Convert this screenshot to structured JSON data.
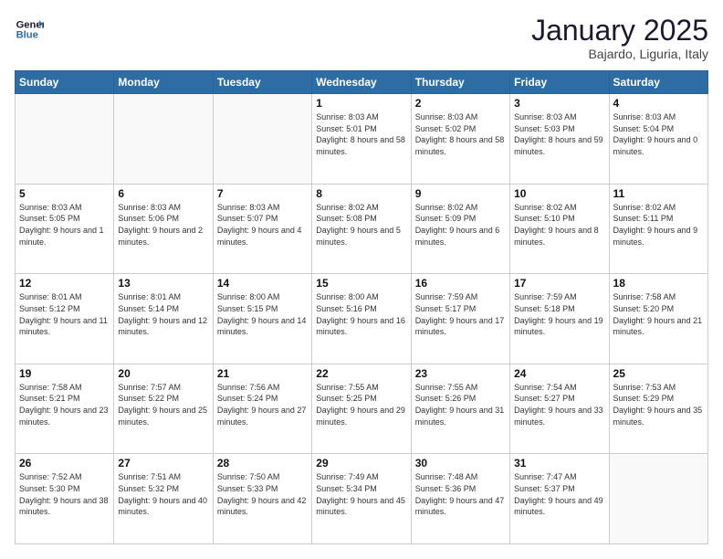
{
  "header": {
    "logo_line1": "General",
    "logo_line2": "Blue",
    "month_title": "January 2025",
    "location": "Bajardo, Liguria, Italy"
  },
  "weekdays": [
    "Sunday",
    "Monday",
    "Tuesday",
    "Wednesday",
    "Thursday",
    "Friday",
    "Saturday"
  ],
  "weeks": [
    [
      {
        "day": "",
        "sunrise": "",
        "sunset": "",
        "daylight": ""
      },
      {
        "day": "",
        "sunrise": "",
        "sunset": "",
        "daylight": ""
      },
      {
        "day": "",
        "sunrise": "",
        "sunset": "",
        "daylight": ""
      },
      {
        "day": "1",
        "sunrise": "Sunrise: 8:03 AM",
        "sunset": "Sunset: 5:01 PM",
        "daylight": "Daylight: 8 hours and 58 minutes."
      },
      {
        "day": "2",
        "sunrise": "Sunrise: 8:03 AM",
        "sunset": "Sunset: 5:02 PM",
        "daylight": "Daylight: 8 hours and 58 minutes."
      },
      {
        "day": "3",
        "sunrise": "Sunrise: 8:03 AM",
        "sunset": "Sunset: 5:03 PM",
        "daylight": "Daylight: 8 hours and 59 minutes."
      },
      {
        "day": "4",
        "sunrise": "Sunrise: 8:03 AM",
        "sunset": "Sunset: 5:04 PM",
        "daylight": "Daylight: 9 hours and 0 minutes."
      }
    ],
    [
      {
        "day": "5",
        "sunrise": "Sunrise: 8:03 AM",
        "sunset": "Sunset: 5:05 PM",
        "daylight": "Daylight: 9 hours and 1 minute."
      },
      {
        "day": "6",
        "sunrise": "Sunrise: 8:03 AM",
        "sunset": "Sunset: 5:06 PM",
        "daylight": "Daylight: 9 hours and 2 minutes."
      },
      {
        "day": "7",
        "sunrise": "Sunrise: 8:03 AM",
        "sunset": "Sunset: 5:07 PM",
        "daylight": "Daylight: 9 hours and 4 minutes."
      },
      {
        "day": "8",
        "sunrise": "Sunrise: 8:02 AM",
        "sunset": "Sunset: 5:08 PM",
        "daylight": "Daylight: 9 hours and 5 minutes."
      },
      {
        "day": "9",
        "sunrise": "Sunrise: 8:02 AM",
        "sunset": "Sunset: 5:09 PM",
        "daylight": "Daylight: 9 hours and 6 minutes."
      },
      {
        "day": "10",
        "sunrise": "Sunrise: 8:02 AM",
        "sunset": "Sunset: 5:10 PM",
        "daylight": "Daylight: 9 hours and 8 minutes."
      },
      {
        "day": "11",
        "sunrise": "Sunrise: 8:02 AM",
        "sunset": "Sunset: 5:11 PM",
        "daylight": "Daylight: 9 hours and 9 minutes."
      }
    ],
    [
      {
        "day": "12",
        "sunrise": "Sunrise: 8:01 AM",
        "sunset": "Sunset: 5:12 PM",
        "daylight": "Daylight: 9 hours and 11 minutes."
      },
      {
        "day": "13",
        "sunrise": "Sunrise: 8:01 AM",
        "sunset": "Sunset: 5:14 PM",
        "daylight": "Daylight: 9 hours and 12 minutes."
      },
      {
        "day": "14",
        "sunrise": "Sunrise: 8:00 AM",
        "sunset": "Sunset: 5:15 PM",
        "daylight": "Daylight: 9 hours and 14 minutes."
      },
      {
        "day": "15",
        "sunrise": "Sunrise: 8:00 AM",
        "sunset": "Sunset: 5:16 PM",
        "daylight": "Daylight: 9 hours and 16 minutes."
      },
      {
        "day": "16",
        "sunrise": "Sunrise: 7:59 AM",
        "sunset": "Sunset: 5:17 PM",
        "daylight": "Daylight: 9 hours and 17 minutes."
      },
      {
        "day": "17",
        "sunrise": "Sunrise: 7:59 AM",
        "sunset": "Sunset: 5:18 PM",
        "daylight": "Daylight: 9 hours and 19 minutes."
      },
      {
        "day": "18",
        "sunrise": "Sunrise: 7:58 AM",
        "sunset": "Sunset: 5:20 PM",
        "daylight": "Daylight: 9 hours and 21 minutes."
      }
    ],
    [
      {
        "day": "19",
        "sunrise": "Sunrise: 7:58 AM",
        "sunset": "Sunset: 5:21 PM",
        "daylight": "Daylight: 9 hours and 23 minutes."
      },
      {
        "day": "20",
        "sunrise": "Sunrise: 7:57 AM",
        "sunset": "Sunset: 5:22 PM",
        "daylight": "Daylight: 9 hours and 25 minutes."
      },
      {
        "day": "21",
        "sunrise": "Sunrise: 7:56 AM",
        "sunset": "Sunset: 5:24 PM",
        "daylight": "Daylight: 9 hours and 27 minutes."
      },
      {
        "day": "22",
        "sunrise": "Sunrise: 7:55 AM",
        "sunset": "Sunset: 5:25 PM",
        "daylight": "Daylight: 9 hours and 29 minutes."
      },
      {
        "day": "23",
        "sunrise": "Sunrise: 7:55 AM",
        "sunset": "Sunset: 5:26 PM",
        "daylight": "Daylight: 9 hours and 31 minutes."
      },
      {
        "day": "24",
        "sunrise": "Sunrise: 7:54 AM",
        "sunset": "Sunset: 5:27 PM",
        "daylight": "Daylight: 9 hours and 33 minutes."
      },
      {
        "day": "25",
        "sunrise": "Sunrise: 7:53 AM",
        "sunset": "Sunset: 5:29 PM",
        "daylight": "Daylight: 9 hours and 35 minutes."
      }
    ],
    [
      {
        "day": "26",
        "sunrise": "Sunrise: 7:52 AM",
        "sunset": "Sunset: 5:30 PM",
        "daylight": "Daylight: 9 hours and 38 minutes."
      },
      {
        "day": "27",
        "sunrise": "Sunrise: 7:51 AM",
        "sunset": "Sunset: 5:32 PM",
        "daylight": "Daylight: 9 hours and 40 minutes."
      },
      {
        "day": "28",
        "sunrise": "Sunrise: 7:50 AM",
        "sunset": "Sunset: 5:33 PM",
        "daylight": "Daylight: 9 hours and 42 minutes."
      },
      {
        "day": "29",
        "sunrise": "Sunrise: 7:49 AM",
        "sunset": "Sunset: 5:34 PM",
        "daylight": "Daylight: 9 hours and 45 minutes."
      },
      {
        "day": "30",
        "sunrise": "Sunrise: 7:48 AM",
        "sunset": "Sunset: 5:36 PM",
        "daylight": "Daylight: 9 hours and 47 minutes."
      },
      {
        "day": "31",
        "sunrise": "Sunrise: 7:47 AM",
        "sunset": "Sunset: 5:37 PM",
        "daylight": "Daylight: 9 hours and 49 minutes."
      },
      {
        "day": "",
        "sunrise": "",
        "sunset": "",
        "daylight": ""
      }
    ]
  ]
}
